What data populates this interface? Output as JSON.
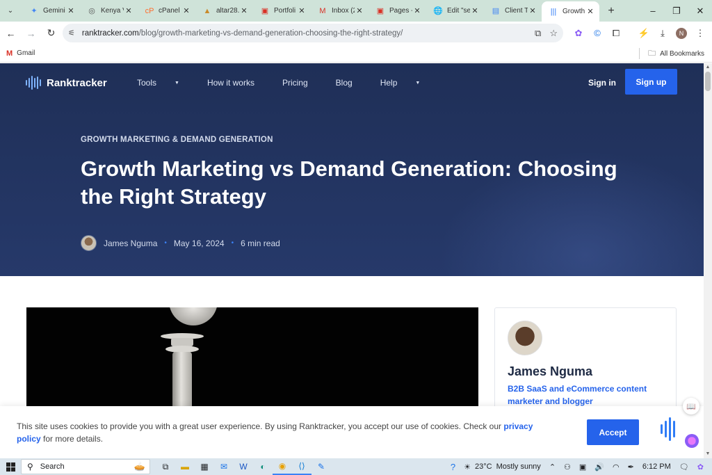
{
  "browser": {
    "tabs": [
      {
        "label": "Gemini",
        "icon": "gemini-sparkle-icon",
        "glyph": "✦",
        "color": "#4285f4"
      },
      {
        "label": "Kenya V",
        "icon": "search-favicon-icon",
        "glyph": "◎",
        "color": "#555555"
      },
      {
        "label": "cPanel",
        "icon": "cpanel-icon",
        "glyph": "cP",
        "color": "#ff6c2c"
      },
      {
        "label": "altar28.",
        "icon": "altar-icon",
        "glyph": "▲",
        "color": "#c98a2a"
      },
      {
        "label": "Portfoli",
        "icon": "pdf-icon",
        "glyph": "▣",
        "color": "#d93025"
      },
      {
        "label": "Inbox (2",
        "icon": "gmail-icon",
        "glyph": "M",
        "color": "#d93025"
      },
      {
        "label": "Pages -",
        "icon": "pdf-icon",
        "glyph": "▣",
        "color": "#d93025"
      },
      {
        "label": "Edit \"se",
        "icon": "globe-icon",
        "glyph": "🌐",
        "color": "#555555"
      },
      {
        "label": "Client T",
        "icon": "docs-icon",
        "glyph": "▤",
        "color": "#4285f4"
      },
      {
        "label": "Growth",
        "icon": "ranktracker-icon",
        "glyph": "|||",
        "color": "#2f7cf6",
        "active": true
      }
    ],
    "url_domain": "ranktracker.com",
    "url_path": "/blog/growth-marketing-vs-demand-generation-choosing-the-right-strategy/",
    "profile_initial": "N",
    "bookmarks": {
      "gmail": "Gmail",
      "all": "All Bookmarks"
    }
  },
  "site": {
    "brand": "Ranktracker",
    "nav": [
      {
        "label": "Tools",
        "caret": true
      },
      {
        "label": "How it works",
        "caret": false
      },
      {
        "label": "Pricing",
        "caret": false
      },
      {
        "label": "Blog",
        "caret": false
      },
      {
        "label": "Help",
        "caret": true
      }
    ],
    "sign_in": "Sign in",
    "sign_up": "Sign up",
    "accent": "#2563eb"
  },
  "article": {
    "category": "GROWTH MARKETING & DEMAND GENERATION",
    "title": "Growth Marketing vs Demand Generation: Choosing the Right Strategy",
    "author": "James Nguma",
    "date": "May 16, 2024",
    "read_time": "6 min read"
  },
  "author_card": {
    "name": "James Nguma",
    "bio": "B2B SaaS and eCommerce content marketer and blogger"
  },
  "cookie": {
    "text_before": "This site uses cookies to provide you with a great user experience. By using Ranktracker, you accept our use of cookies. Check our ",
    "link": "privacy policy",
    "text_after": " for more details.",
    "accept": "Accept"
  },
  "taskbar": {
    "search_placeholder": "Search",
    "weather": "23°C",
    "weather_desc": "Mostly sunny",
    "time": "6:12 PM"
  }
}
